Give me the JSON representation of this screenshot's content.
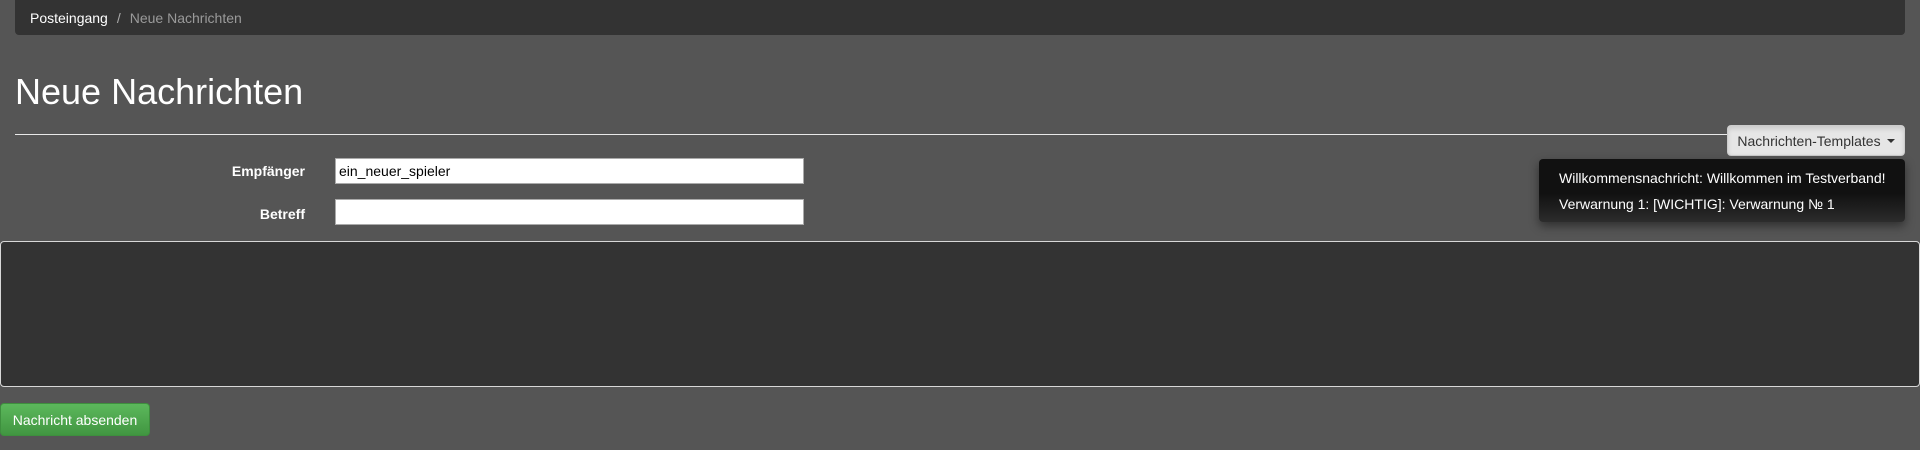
{
  "breadcrumb": {
    "items": [
      {
        "label": "Posteingang"
      },
      {
        "label": "Neue Nachrichten"
      }
    ],
    "separator": "/"
  },
  "page": {
    "title": "Neue Nachrichten"
  },
  "templates": {
    "button_label": "Nachrichten-Templates",
    "items": [
      {
        "label": "Willkommensnachricht: Willkommen im Testverband!"
      },
      {
        "label": "Verwarnung 1: [WICHTIG]: Verwarnung № 1"
      }
    ]
  },
  "form": {
    "recipient_label": "Empfänger",
    "recipient_value": "ein_neuer_spieler",
    "subject_label": "Betreff",
    "subject_value": "",
    "body_value": ""
  },
  "actions": {
    "send_label": "Nachricht absenden"
  },
  "colors": {
    "background": "#555555",
    "panel": "#333333",
    "send_button": "#5cb85c",
    "dropdown": "#111111"
  }
}
